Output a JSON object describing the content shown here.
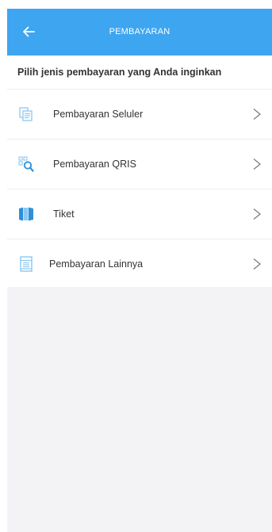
{
  "header": {
    "title": "PEMBAYARAN",
    "back_icon": "arrow-left-icon"
  },
  "subheader": {
    "text": "Pilih jenis pembayaran yang Anda inginkan"
  },
  "menu": {
    "items": [
      {
        "label": "Pembayaran Seluler",
        "icon": "mobile-payment-icon"
      },
      {
        "label": "Pembayaran QRIS",
        "icon": "qris-scan-icon"
      },
      {
        "label": "Tiket",
        "icon": "ticket-icon"
      },
      {
        "label": "Pembayaran Lainnya",
        "icon": "other-payment-icon"
      }
    ]
  },
  "colors": {
    "appbar": "#3ea5f0",
    "icon_blue": "#2f8fd8",
    "icon_light_blue": "#8cc8f2",
    "background_grey": "#f3f3f5"
  }
}
